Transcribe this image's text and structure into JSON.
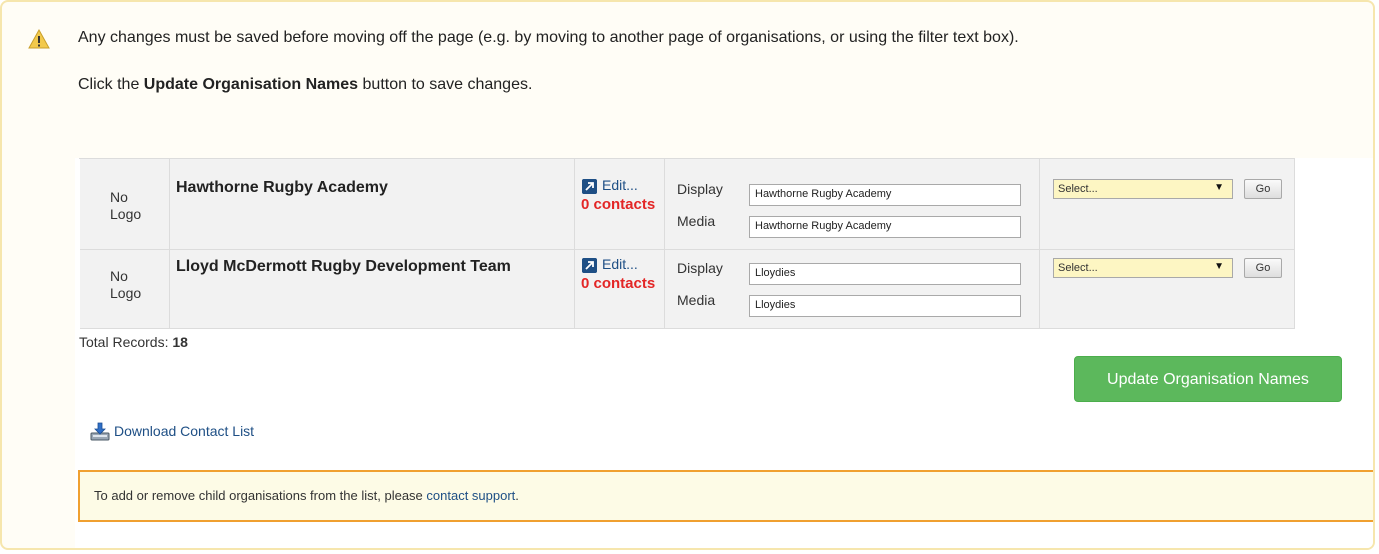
{
  "warning": {
    "line1": "Any changes must be saved before moving off the page (e.g. by moving to another page of organisations, or using the filter text box).",
    "line2_pre": "Click the ",
    "line2_bold": "Update Organisation Names",
    "line2_post": " button to save changes."
  },
  "rows": [
    {
      "logo": "No Logo",
      "name": "Hawthorne Rugby Academy",
      "edit": "Edit...",
      "contacts": "0 contacts",
      "display_label": "Display",
      "display_value": "Hawthorne Rugby Academy",
      "media_label": "Media",
      "media_value": "Hawthorne Rugby Academy",
      "select": "Select...",
      "go": "Go"
    },
    {
      "logo": "No Logo",
      "name": "Lloyd McDermott Rugby Development Team",
      "edit": "Edit...",
      "contacts": "0 contacts",
      "display_label": "Display",
      "display_value": "Lloydies",
      "media_label": "Media",
      "media_value": "Lloydies",
      "select": "Select...",
      "go": "Go"
    }
  ],
  "total": {
    "label": "Total Records: ",
    "value": "18"
  },
  "update_button": "Update Organisation Names",
  "download_link": "Download Contact List",
  "notice": {
    "text": "To add or remove child organisations from the list, please ",
    "link": "contact support",
    "end": "."
  },
  "icons": {
    "warning": "warning-triangle-icon",
    "edit": "external-link-icon",
    "download": "download-icon"
  },
  "colors": {
    "contacts_red": "#e32626",
    "update_green": "#5cb85c",
    "link_blue": "#1e4f85",
    "notice_border": "#f0a030",
    "select_bg": "#fdf6c3"
  }
}
